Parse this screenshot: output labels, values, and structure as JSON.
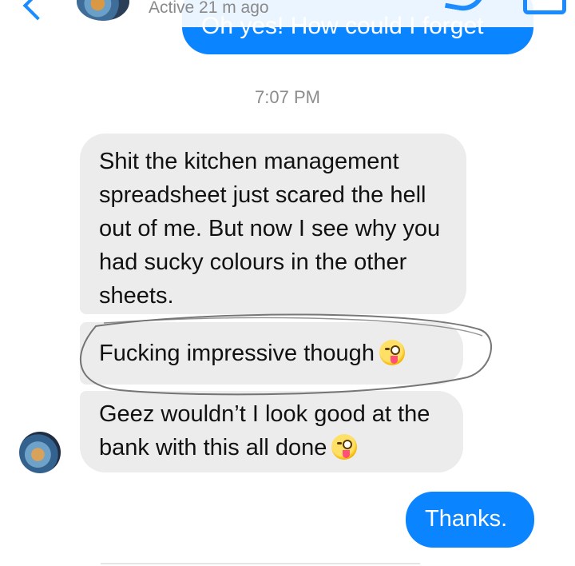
{
  "header": {
    "status": "Active 21 m ago",
    "icons": [
      "back-chevron-icon",
      "contact-avatar",
      "phone-icon",
      "video-icon"
    ]
  },
  "messages": {
    "outgoing_top": "Oh yes!  How could I forget",
    "timestamp": "7:07 PM",
    "incoming_1": "Shit the kitchen management spreadsheet just scared the hell out of me. But now I see why you had sucky colours in the other sheets.",
    "incoming_2": "Fucking impressive though",
    "incoming_3": "Geez wouldn’t I look good at the bank with this all done",
    "outgoing_bottom": "Thanks."
  },
  "colors": {
    "outgoing_bubble": "#0b84ff",
    "incoming_bubble": "#ececec",
    "accent": "#1a8cff"
  }
}
